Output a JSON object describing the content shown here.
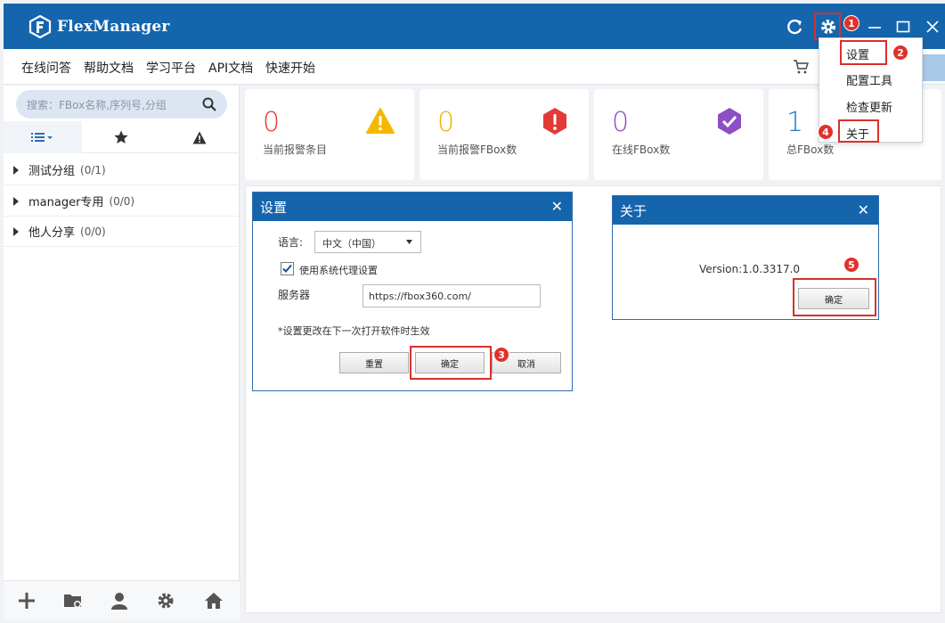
{
  "app": {
    "title": "FlexManager"
  },
  "menubar": {
    "items": [
      "在线问答",
      "帮助文档",
      "学习平台",
      "API文档",
      "快速开始"
    ]
  },
  "sidebar": {
    "search_placeholder": "搜索：FBox名称,序列号,分组",
    "tree": [
      {
        "label": "测试分组",
        "count": "(0/1)"
      },
      {
        "label": "manager专用",
        "count": "(0/0)"
      },
      {
        "label": "他人分享",
        "count": "(0/0)"
      }
    ]
  },
  "stats": [
    {
      "value": "0",
      "label": "当前报警条目",
      "color": "#e53935"
    },
    {
      "value": "0",
      "label": "当前报警FBox数",
      "color": "#f0b400"
    },
    {
      "value": "0",
      "label": "在线FBox数",
      "color": "#8e4ec6"
    },
    {
      "value": "1",
      "label": "总FBox数",
      "color": "#1e78c8"
    }
  ],
  "settings_menu": {
    "items": [
      "设置",
      "配置工具",
      "检查更新",
      "关于"
    ]
  },
  "settings_dialog": {
    "title": "设置",
    "language_label": "语言:",
    "language_value": "中文（中国）",
    "proxy_label": "使用系统代理设置",
    "proxy_checked": true,
    "server_label": "服务器",
    "server_value": "https://fbox360.com/",
    "note": "*设置更改在下一次打开软件时生效",
    "reset_label": "重置",
    "ok_label": "确定",
    "cancel_label": "取消"
  },
  "about_dialog": {
    "title": "关于",
    "version": "Version:1.0.3317.0",
    "ok_label": "确定"
  },
  "annotations": [
    "1",
    "2",
    "3",
    "4",
    "5"
  ],
  "colors": {
    "brand": "#1565ad",
    "highlight": "#d9302a"
  }
}
